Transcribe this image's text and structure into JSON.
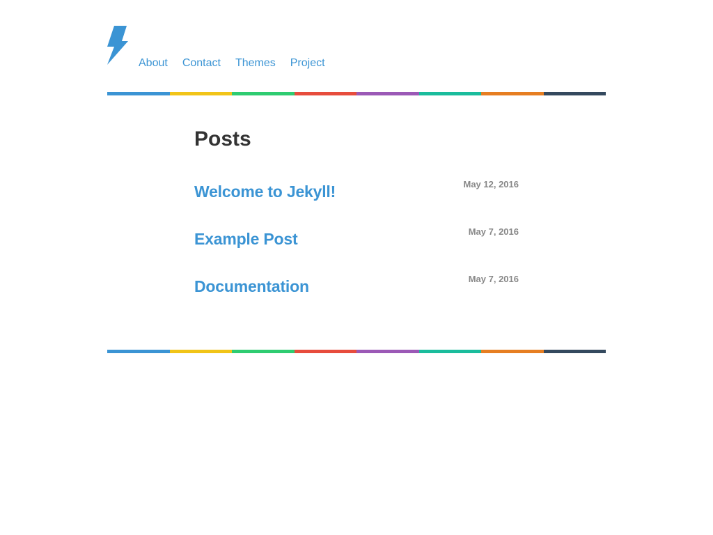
{
  "header": {
    "nav": [
      {
        "label": "About"
      },
      {
        "label": "Contact"
      },
      {
        "label": "Themes"
      },
      {
        "label": "Project"
      }
    ],
    "rainbow_colors": [
      "#3b94d4",
      "#f1c418",
      "#2ecc71",
      "#e74c3c",
      "#9b59b6",
      "#1abc9c",
      "#e67e22",
      "#34495e"
    ],
    "logo_icon": "lightning-bolt-icon",
    "accent_color": "#3b94d4"
  },
  "main": {
    "title": "Posts",
    "posts": [
      {
        "title": "Welcome to Jekyll!",
        "date": "May 12, 2016"
      },
      {
        "title": "Example Post",
        "date": "May 7, 2016"
      },
      {
        "title": "Documentation",
        "date": "May 7, 2016"
      }
    ]
  }
}
